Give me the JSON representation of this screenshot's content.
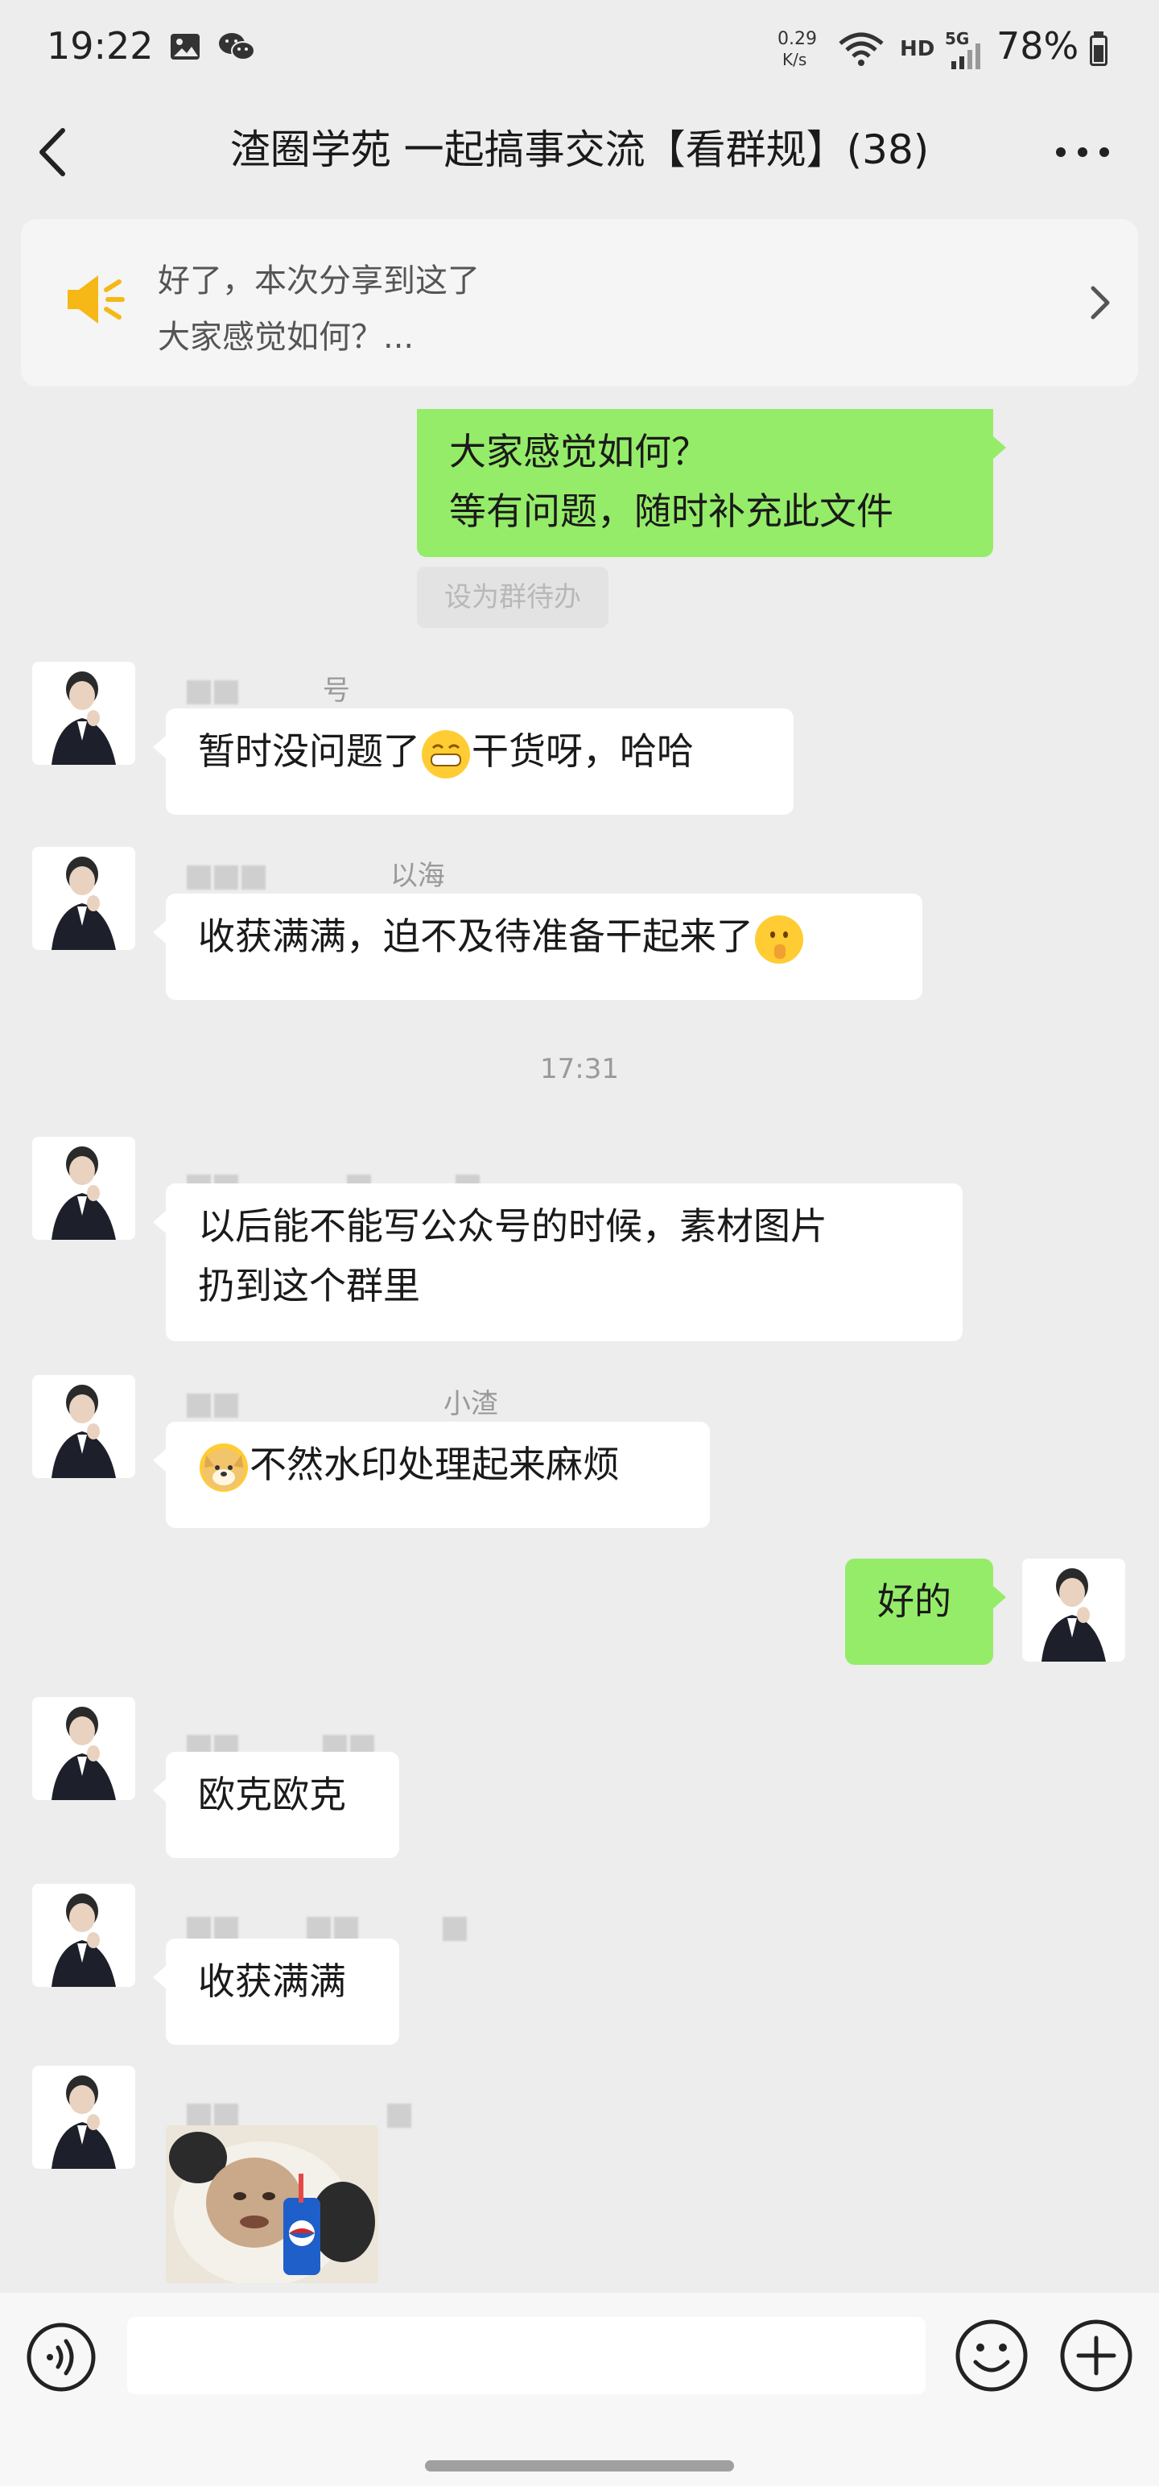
{
  "status_bar": {
    "time": "19:22",
    "net_speed_top": "0.29",
    "net_speed_bottom": "K/s",
    "hd": "HD",
    "signal": "5G",
    "battery": "78%",
    "battery_level": 0.78,
    "icons": [
      "gallery-icon",
      "wechat-icon",
      "wifi-icon",
      "signal-icon",
      "battery-icon"
    ]
  },
  "header": {
    "title": "渣圈学苑 一起搞事交流【看群规】(38)",
    "back_icon": "chevron-left-icon",
    "more_icon": "more-dots-icon"
  },
  "pinned": {
    "icon": "speaker-icon",
    "line1": "好了，本次分享到这了",
    "line2": "大家感觉如何？...",
    "arrow_icon": "chevron-right-icon"
  },
  "messages": [
    {
      "side": "right",
      "lines": [
        "大家感觉如何？",
        "等有问题，随时补充此文件"
      ],
      "action": "设为群待办"
    },
    {
      "side": "left",
      "sender_suffix": "号",
      "text_before": "暂时没问题了",
      "emoji": "grin-emoji",
      "text_after": "干货呀，哈哈"
    },
    {
      "side": "left",
      "sender_suffix": "以海",
      "text_before": "收获满满，迫不及待准备干起来了",
      "emoji": "shush-emoji",
      "text_after": ""
    },
    {
      "timestamp": "17:31"
    },
    {
      "side": "left",
      "sender_suffix": "",
      "lines": [
        "以后能不能写公众号的时候，素材图片",
        "扔到这个群里"
      ]
    },
    {
      "side": "left",
      "sender_suffix": "小渣",
      "emoji": "doge-emoji",
      "text_after": "不然水印处理起来麻烦"
    },
    {
      "side": "right",
      "text": "好的"
    },
    {
      "side": "left",
      "sender_suffix": "",
      "text": "欧克欧克"
    },
    {
      "side": "left",
      "sender_suffix": "",
      "text": "收获满满"
    },
    {
      "side": "left",
      "sender_suffix": "",
      "sticker": "panda-sticker"
    }
  ],
  "input_bar": {
    "voice_icon": "voice-icon",
    "emoji_icon": "smiley-icon",
    "plus_icon": "plus-icon",
    "placeholder": ""
  }
}
